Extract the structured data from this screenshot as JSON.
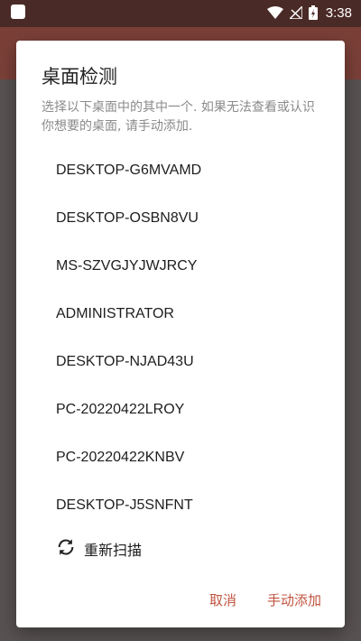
{
  "status_bar": {
    "time": "3:38",
    "icons": [
      "wifi-icon",
      "signal-off-icon",
      "battery-charging-icon"
    ]
  },
  "colors": {
    "accent": "#c0533f",
    "app_bar": "#7a4038",
    "dialog_bg": "#ffffff"
  },
  "dialog": {
    "title": "桌面检测",
    "message": "选择以下桌面中的其中一个. 如果无法查看或认识你想要的桌面, 请手动添加.",
    "desktops": [
      "DESKTOP-G6MVAMD",
      "DESKTOP-OSBN8VU",
      "MS-SZVGJYJWJRCY",
      "ADMINISTRATOR",
      "DESKTOP-NJAD43U",
      "PC-20220422LROY",
      "PC-20220422KNBV",
      "DESKTOP-J5SNFNT"
    ],
    "rescan_label": "重新扫描",
    "rescan_icon": "refresh-icon",
    "cancel_label": "取消",
    "manual_add_label": "手动添加"
  }
}
